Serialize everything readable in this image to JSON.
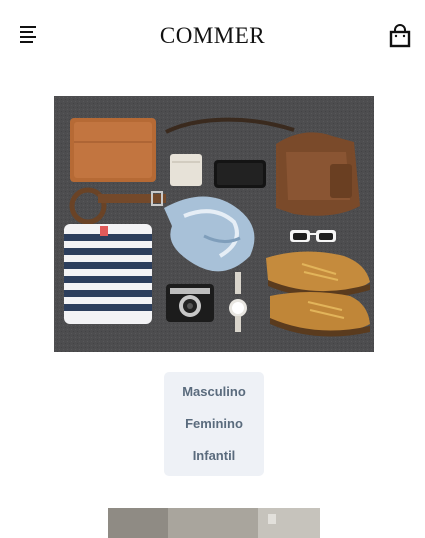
{
  "header": {
    "brand": "COMMER",
    "menu_icon": "menu-lines-icon",
    "cart_icon": "shopping-bag-icon"
  },
  "hero": {
    "description_icon": "flatlay-image"
  },
  "categories": [
    {
      "label": "Masculino"
    },
    {
      "label": "Feminino"
    },
    {
      "label": "Infantil"
    }
  ],
  "colors": {
    "menu_bg": "#eef1f6",
    "menu_text": "#5a6b7d",
    "brand": "#111111"
  }
}
